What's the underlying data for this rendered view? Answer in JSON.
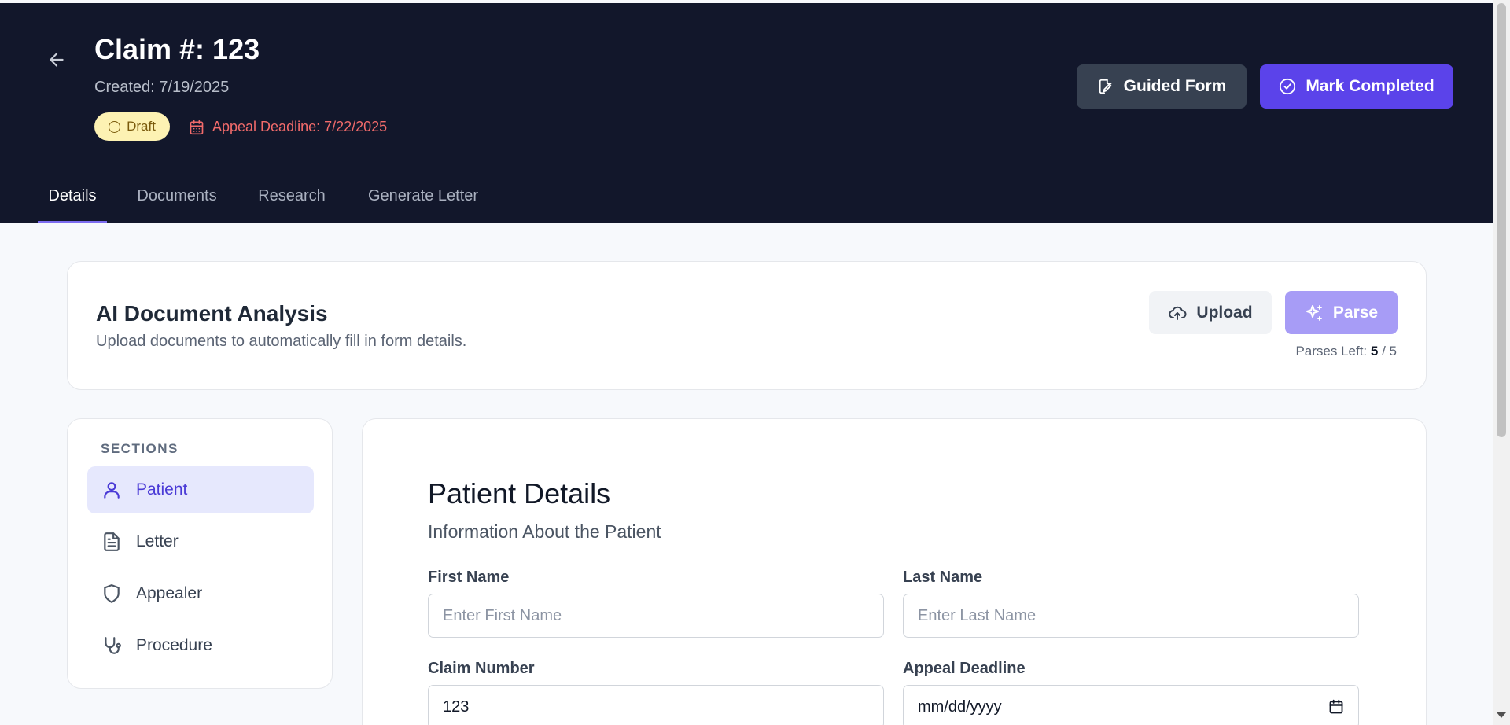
{
  "header": {
    "title": "Claim #: 123",
    "created": "Created: 7/19/2025",
    "status": "Draft",
    "deadline": "Appeal Deadline: 7/22/2025",
    "guided_form": "Guided Form",
    "mark_completed": "Mark Completed"
  },
  "tabs": [
    {
      "label": "Details",
      "active": true
    },
    {
      "label": "Documents",
      "active": false
    },
    {
      "label": "Research",
      "active": false
    },
    {
      "label": "Generate Letter",
      "active": false
    }
  ],
  "ai": {
    "title": "AI Document Analysis",
    "subtitle": "Upload documents to automatically fill in form details.",
    "upload": "Upload",
    "parse": "Parse",
    "parses_label": "Parses Left:",
    "parses_used": "5",
    "parses_total": "/ 5"
  },
  "sections": {
    "label": "SECTIONS",
    "items": [
      {
        "label": "Patient",
        "icon": "user-icon",
        "active": true
      },
      {
        "label": "Letter",
        "icon": "document-icon",
        "active": false
      },
      {
        "label": "Appealer",
        "icon": "shield-icon",
        "active": false
      },
      {
        "label": "Procedure",
        "icon": "stethoscope-icon",
        "active": false
      }
    ]
  },
  "patient": {
    "title": "Patient Details",
    "subtitle": "Information About the Patient",
    "first_name_label": "First Name",
    "first_name_placeholder": "Enter First Name",
    "first_name_value": "",
    "last_name_label": "Last Name",
    "last_name_placeholder": "Enter Last Name",
    "last_name_value": "",
    "claim_number_label": "Claim Number",
    "claim_number_value": "123",
    "appeal_deadline_label": "Appeal Deadline",
    "appeal_deadline_value": "mm/dd/yyyy"
  },
  "colors": {
    "header_bg": "#12172b",
    "accent": "#5b43ea",
    "parse_disabled": "#a79cf6",
    "deadline_red": "#f26b6b",
    "draft_badge": "#fdf2b3"
  }
}
